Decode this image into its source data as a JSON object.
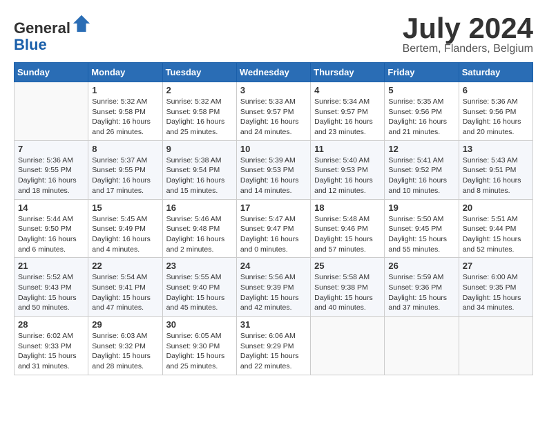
{
  "header": {
    "logo_line1": "General",
    "logo_line2": "Blue",
    "month_title": "July 2024",
    "location": "Bertem, Flanders, Belgium"
  },
  "days_of_week": [
    "Sunday",
    "Monday",
    "Tuesday",
    "Wednesday",
    "Thursday",
    "Friday",
    "Saturday"
  ],
  "weeks": [
    [
      {
        "day": "",
        "info": ""
      },
      {
        "day": "1",
        "info": "Sunrise: 5:32 AM\nSunset: 9:58 PM\nDaylight: 16 hours\nand 26 minutes."
      },
      {
        "day": "2",
        "info": "Sunrise: 5:32 AM\nSunset: 9:58 PM\nDaylight: 16 hours\nand 25 minutes."
      },
      {
        "day": "3",
        "info": "Sunrise: 5:33 AM\nSunset: 9:57 PM\nDaylight: 16 hours\nand 24 minutes."
      },
      {
        "day": "4",
        "info": "Sunrise: 5:34 AM\nSunset: 9:57 PM\nDaylight: 16 hours\nand 23 minutes."
      },
      {
        "day": "5",
        "info": "Sunrise: 5:35 AM\nSunset: 9:56 PM\nDaylight: 16 hours\nand 21 minutes."
      },
      {
        "day": "6",
        "info": "Sunrise: 5:36 AM\nSunset: 9:56 PM\nDaylight: 16 hours\nand 20 minutes."
      }
    ],
    [
      {
        "day": "7",
        "info": "Sunrise: 5:36 AM\nSunset: 9:55 PM\nDaylight: 16 hours\nand 18 minutes."
      },
      {
        "day": "8",
        "info": "Sunrise: 5:37 AM\nSunset: 9:55 PM\nDaylight: 16 hours\nand 17 minutes."
      },
      {
        "day": "9",
        "info": "Sunrise: 5:38 AM\nSunset: 9:54 PM\nDaylight: 16 hours\nand 15 minutes."
      },
      {
        "day": "10",
        "info": "Sunrise: 5:39 AM\nSunset: 9:53 PM\nDaylight: 16 hours\nand 14 minutes."
      },
      {
        "day": "11",
        "info": "Sunrise: 5:40 AM\nSunset: 9:53 PM\nDaylight: 16 hours\nand 12 minutes."
      },
      {
        "day": "12",
        "info": "Sunrise: 5:41 AM\nSunset: 9:52 PM\nDaylight: 16 hours\nand 10 minutes."
      },
      {
        "day": "13",
        "info": "Sunrise: 5:43 AM\nSunset: 9:51 PM\nDaylight: 16 hours\nand 8 minutes."
      }
    ],
    [
      {
        "day": "14",
        "info": "Sunrise: 5:44 AM\nSunset: 9:50 PM\nDaylight: 16 hours\nand 6 minutes."
      },
      {
        "day": "15",
        "info": "Sunrise: 5:45 AM\nSunset: 9:49 PM\nDaylight: 16 hours\nand 4 minutes."
      },
      {
        "day": "16",
        "info": "Sunrise: 5:46 AM\nSunset: 9:48 PM\nDaylight: 16 hours\nand 2 minutes."
      },
      {
        "day": "17",
        "info": "Sunrise: 5:47 AM\nSunset: 9:47 PM\nDaylight: 16 hours\nand 0 minutes."
      },
      {
        "day": "18",
        "info": "Sunrise: 5:48 AM\nSunset: 9:46 PM\nDaylight: 15 hours\nand 57 minutes."
      },
      {
        "day": "19",
        "info": "Sunrise: 5:50 AM\nSunset: 9:45 PM\nDaylight: 15 hours\nand 55 minutes."
      },
      {
        "day": "20",
        "info": "Sunrise: 5:51 AM\nSunset: 9:44 PM\nDaylight: 15 hours\nand 52 minutes."
      }
    ],
    [
      {
        "day": "21",
        "info": "Sunrise: 5:52 AM\nSunset: 9:43 PM\nDaylight: 15 hours\nand 50 minutes."
      },
      {
        "day": "22",
        "info": "Sunrise: 5:54 AM\nSunset: 9:41 PM\nDaylight: 15 hours\nand 47 minutes."
      },
      {
        "day": "23",
        "info": "Sunrise: 5:55 AM\nSunset: 9:40 PM\nDaylight: 15 hours\nand 45 minutes."
      },
      {
        "day": "24",
        "info": "Sunrise: 5:56 AM\nSunset: 9:39 PM\nDaylight: 15 hours\nand 42 minutes."
      },
      {
        "day": "25",
        "info": "Sunrise: 5:58 AM\nSunset: 9:38 PM\nDaylight: 15 hours\nand 40 minutes."
      },
      {
        "day": "26",
        "info": "Sunrise: 5:59 AM\nSunset: 9:36 PM\nDaylight: 15 hours\nand 37 minutes."
      },
      {
        "day": "27",
        "info": "Sunrise: 6:00 AM\nSunset: 9:35 PM\nDaylight: 15 hours\nand 34 minutes."
      }
    ],
    [
      {
        "day": "28",
        "info": "Sunrise: 6:02 AM\nSunset: 9:33 PM\nDaylight: 15 hours\nand 31 minutes."
      },
      {
        "day": "29",
        "info": "Sunrise: 6:03 AM\nSunset: 9:32 PM\nDaylight: 15 hours\nand 28 minutes."
      },
      {
        "day": "30",
        "info": "Sunrise: 6:05 AM\nSunset: 9:30 PM\nDaylight: 15 hours\nand 25 minutes."
      },
      {
        "day": "31",
        "info": "Sunrise: 6:06 AM\nSunset: 9:29 PM\nDaylight: 15 hours\nand 22 minutes."
      },
      {
        "day": "",
        "info": ""
      },
      {
        "day": "",
        "info": ""
      },
      {
        "day": "",
        "info": ""
      }
    ]
  ]
}
